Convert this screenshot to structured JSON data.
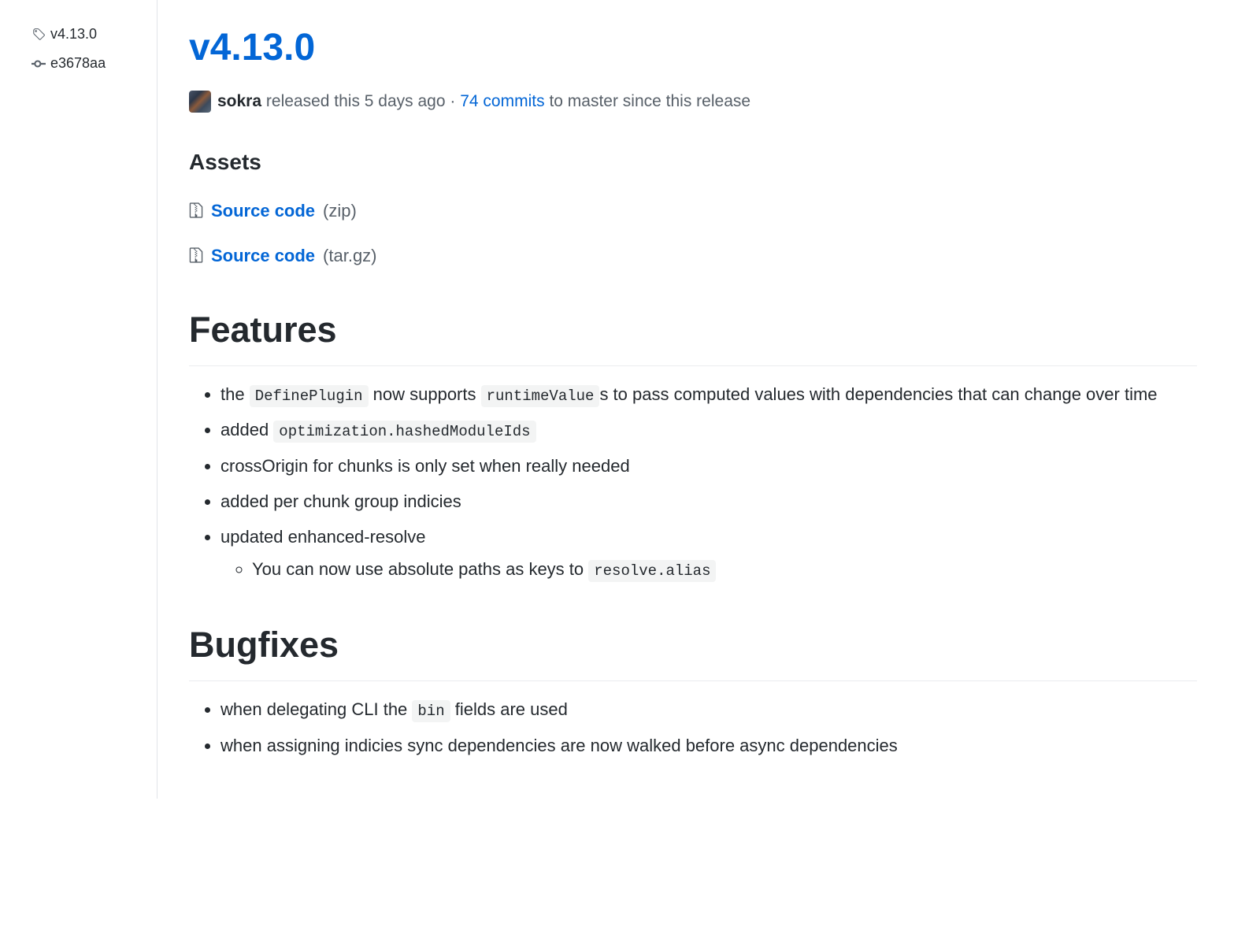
{
  "sidebar": {
    "tag": "v4.13.0",
    "commit": "e3678aa"
  },
  "release": {
    "title": "v4.13.0",
    "author": "sokra",
    "released_text": "released this 5 days ago",
    "separator": "·",
    "commits_link": "74 commits",
    "commits_suffix": "to master since this release"
  },
  "assets": {
    "heading": "Assets",
    "items": [
      {
        "name": "Source code",
        "ext": "(zip)"
      },
      {
        "name": "Source code",
        "ext": "(tar.gz)"
      }
    ]
  },
  "features": {
    "heading": "Features",
    "item1_a": "the ",
    "item1_code1": "DefinePlugin",
    "item1_b": " now supports ",
    "item1_code2": "runtimeValue",
    "item1_c": "s to pass computed values with dependencies that can change over time",
    "item2_a": "added ",
    "item2_code": "optimization.hashedModuleIds",
    "item3": "crossOrigin for chunks is only set when really needed",
    "item4": "added per chunk group indicies",
    "item5": "updated enhanced-resolve",
    "item5_sub_a": "You can now use absolute paths as keys to ",
    "item5_sub_code": "resolve.alias"
  },
  "bugfixes": {
    "heading": "Bugfixes",
    "item1_a": "when delegating CLI the ",
    "item1_code": "bin",
    "item1_b": " fields are used",
    "item2": "when assigning indicies sync dependencies are now walked before async dependencies"
  }
}
